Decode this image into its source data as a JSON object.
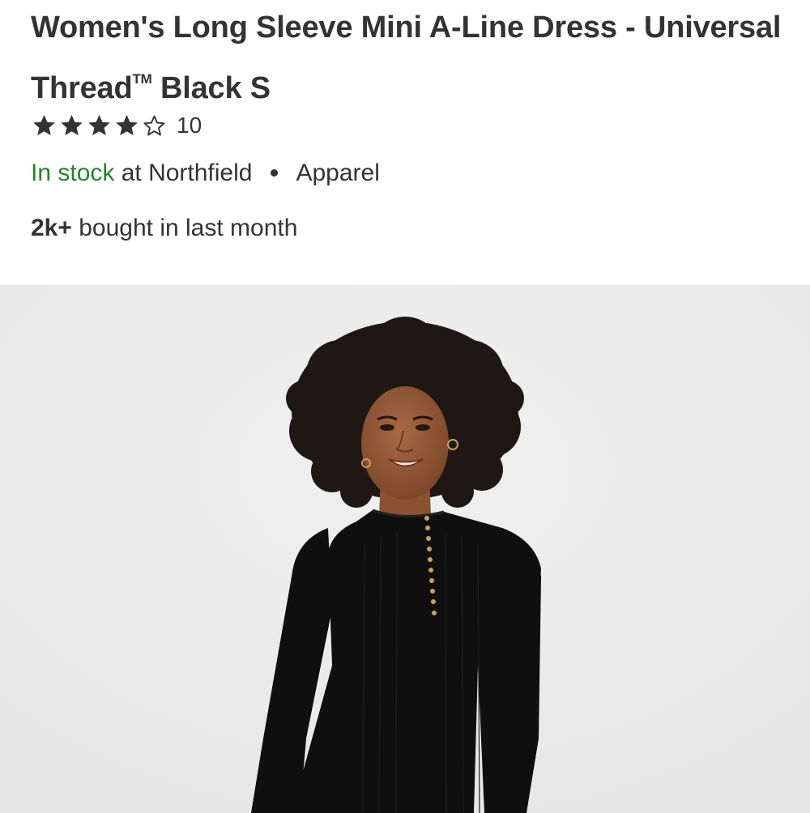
{
  "product": {
    "title_main": "Women's Long Sleeve Mini A-Line Dress - Universal Thread",
    "title_trademark": "TM",
    "title_variant": " Black S",
    "rating": {
      "value": 4,
      "max": 5,
      "count": "10"
    },
    "availability": {
      "status": "In stock",
      "location_text": " at Northfield",
      "category": "Apparel",
      "status_color": "#218626"
    },
    "purchases": {
      "count": "2k+",
      "text": " bought in last month"
    }
  },
  "icons": {
    "filled_star": "star-filled-icon",
    "empty_star": "star-outline-icon"
  },
  "colors": {
    "text": "#333333",
    "in_stock": "#218626",
    "photo_background": "#ebebeb"
  }
}
